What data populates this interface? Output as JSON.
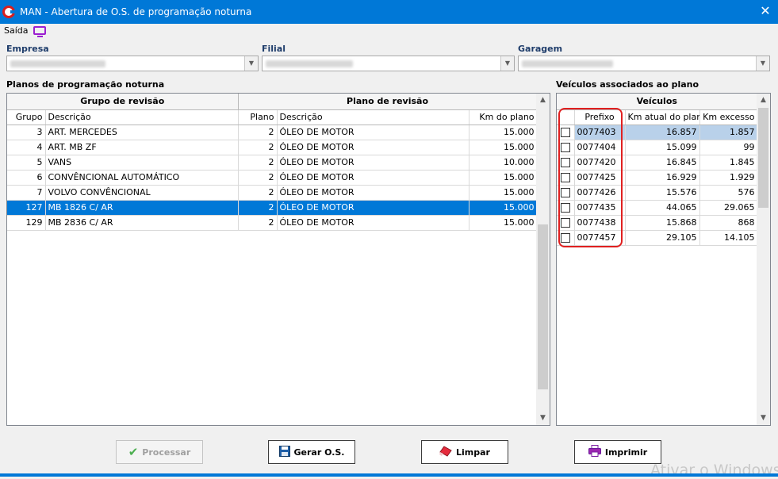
{
  "window": {
    "title": "MAN - Abertura de O.S. de programação noturna",
    "close_label": "✕"
  },
  "menu": {
    "saida_label": "Saída"
  },
  "filters": {
    "empresa_label": "Empresa",
    "filial_label": "Filial",
    "garagem_label": "Garagem"
  },
  "planos": {
    "section_title": "Planos de programação noturna",
    "group_headers": [
      "Grupo de revisão",
      "Plano de revisão"
    ],
    "columns": [
      "Grupo",
      "Descrição",
      "Plano",
      "Descrição",
      "Km do plano"
    ],
    "rows": [
      {
        "grupo": "3",
        "descricao": "ART. MERCEDES",
        "plano": "2",
        "descricao_plano": "ÓLEO DE MOTOR",
        "km": "15.000"
      },
      {
        "grupo": "4",
        "descricao": "ART. MB ZF",
        "plano": "2",
        "descricao_plano": "ÓLEO DE MOTOR",
        "km": "15.000"
      },
      {
        "grupo": "5",
        "descricao": "VANS",
        "plano": "2",
        "descricao_plano": "ÓLEO DE MOTOR",
        "km": "10.000"
      },
      {
        "grupo": "6",
        "descricao": "CONVÊNCIONAL AUTOMÁTICO",
        "plano": "2",
        "descricao_plano": "ÓLEO DE MOTOR",
        "km": "15.000"
      },
      {
        "grupo": "7",
        "descricao": "VOLVO CONVÊNCIONAL",
        "plano": "2",
        "descricao_plano": "ÓLEO DE MOTOR",
        "km": "15.000"
      },
      {
        "grupo": "127",
        "descricao": "MB 1826 C/ AR",
        "plano": "2",
        "descricao_plano": "ÓLEO DE MOTOR",
        "km": "15.000"
      },
      {
        "grupo": "129",
        "descricao": "MB 2836 C/ AR",
        "plano": "2",
        "descricao_plano": "ÓLEO DE MOTOR",
        "km": "15.000"
      }
    ],
    "selected_index": 5
  },
  "veiculos": {
    "section_title": "Veículos associados ao plano",
    "group_header": "Veículos",
    "columns": [
      "",
      "Prefixo",
      "Km atual do plano",
      "Km excesso"
    ],
    "rows": [
      {
        "prefixo": "0077403",
        "km_atual": "16.857",
        "km_excesso": "1.857"
      },
      {
        "prefixo": "0077404",
        "km_atual": "15.099",
        "km_excesso": "99"
      },
      {
        "prefixo": "0077420",
        "km_atual": "16.845",
        "km_excesso": "1.845"
      },
      {
        "prefixo": "0077425",
        "km_atual": "16.929",
        "km_excesso": "1.929"
      },
      {
        "prefixo": "0077426",
        "km_atual": "15.576",
        "km_excesso": "576"
      },
      {
        "prefixo": "0077435",
        "km_atual": "44.065",
        "km_excesso": "29.065"
      },
      {
        "prefixo": "0077438",
        "km_atual": "15.868",
        "km_excesso": "868"
      },
      {
        "prefixo": "0077457",
        "km_atual": "29.105",
        "km_excesso": "14.105"
      }
    ],
    "highlighted_index": 0
  },
  "buttons": {
    "processar": "Processar",
    "gerar_os": "Gerar O.S.",
    "limpar": "Limpar",
    "imprimir": "Imprimir"
  },
  "watermark": "Ativar o Windows",
  "colors": {
    "titlebar": "#0078d7",
    "selection": "#0078d7",
    "highlight": "#b9d1ea",
    "annotation": "#e02020"
  }
}
